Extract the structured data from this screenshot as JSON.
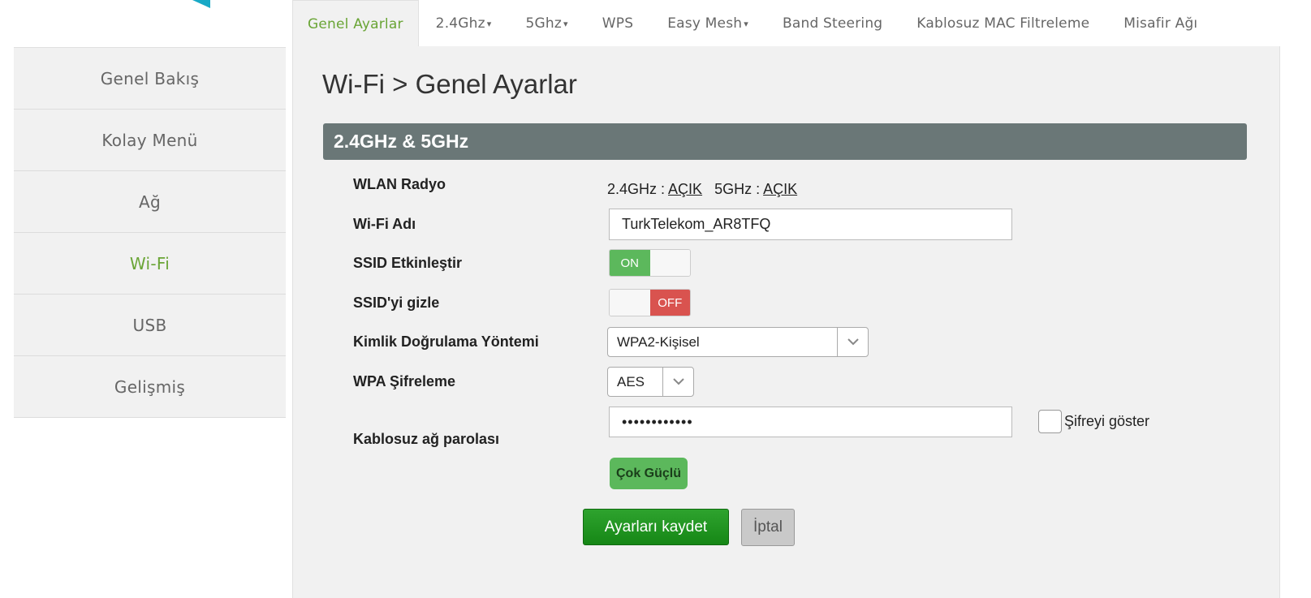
{
  "tabs": [
    {
      "label": "Genel Ayarlar",
      "dropdown": false,
      "active": true
    },
    {
      "label": "2.4Ghz",
      "dropdown": true
    },
    {
      "label": "5Ghz",
      "dropdown": true
    },
    {
      "label": "WPS",
      "dropdown": false
    },
    {
      "label": "Easy Mesh",
      "dropdown": true
    },
    {
      "label": "Band Steering",
      "dropdown": false
    },
    {
      "label": "Kablosuz MAC Filtreleme",
      "dropdown": false
    },
    {
      "label": "Misafir Ağı",
      "dropdown": false
    }
  ],
  "sidebar": {
    "items": [
      {
        "label": "Genel Bakış"
      },
      {
        "label": "Kolay Menü"
      },
      {
        "label": "Ağ"
      },
      {
        "label": "Wi-Fi",
        "active": true
      },
      {
        "label": "USB"
      },
      {
        "label": "Gelişmiş"
      }
    ]
  },
  "main": {
    "title": "Wi-Fi > Genel Ayarlar",
    "section": "2.4GHz & 5GHz",
    "fields": {
      "wlan_radio": {
        "label": "WLAN Radyo",
        "band24_prefix": "2.4GHz : ",
        "band24_state": "AÇIK",
        "band5_prefix": "5GHz : ",
        "band5_state": "AÇIK"
      },
      "wifi_name": {
        "label": "Wi-Fi Adı",
        "value": "TurkTelekom_AR8TFQ"
      },
      "ssid_enable": {
        "label": "SSID Etkinleştir",
        "state": "ON"
      },
      "ssid_hide": {
        "label": "SSID'yi gizle",
        "state": "OFF"
      },
      "auth_method": {
        "label": "Kimlik Doğrulama Yöntemi",
        "value": "WPA2-Kişisel"
      },
      "wpa_encryption": {
        "label": "WPA Şifreleme",
        "value": "AES"
      },
      "password": {
        "label": "Kablosuz ağ parolası",
        "value": "••••••••••••",
        "show_label": "Şifreyi göster",
        "strength": "Çok Güçlü"
      }
    },
    "buttons": {
      "save": "Ayarları kaydet",
      "cancel": "İptal"
    }
  },
  "colors": {
    "accent_green": "#6aa536",
    "section_bar": "#6a7777",
    "toggle_on": "#5cb85c",
    "toggle_off": "#d9534f",
    "save_button": "#1f961f"
  }
}
